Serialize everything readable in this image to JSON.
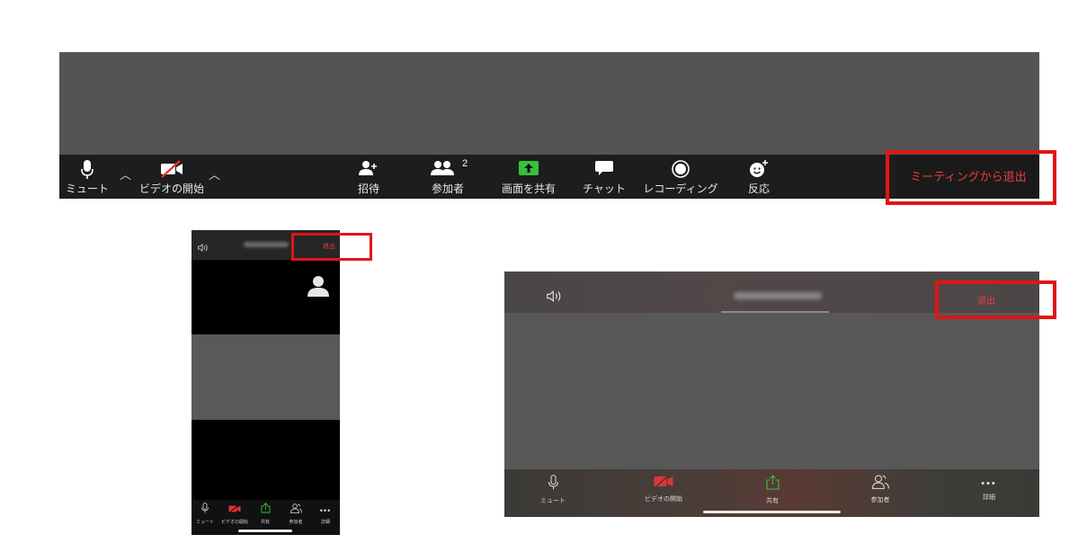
{
  "desktop": {
    "toolbar": {
      "mute_label": "ミュート",
      "video_label": "ビデオの開始",
      "invite_label": "招待",
      "participants_label": "参加者",
      "participants_count": "2",
      "share_label": "画面を共有",
      "chat_label": "チャット",
      "record_label": "レコーディング",
      "reactions_label": "反応",
      "leave_label": "ミーティングから退出"
    }
  },
  "phone": {
    "leave_label": "退出",
    "toolbar": {
      "mute_label": "ミュート",
      "video_label": "ビデオの開始",
      "share_label": "共有",
      "participants_label": "参加者",
      "more_label": "詳細"
    }
  },
  "tablet": {
    "leave_label": "退出",
    "toolbar": {
      "mute_label": "ミュート",
      "video_label": "ビデオの開始",
      "share_label": "共有",
      "participants_label": "参加者",
      "more_label": "詳細"
    }
  },
  "colors": {
    "leave_red": "#ef3f3f",
    "highlight_red": "#e01616",
    "share_green": "#35c13b",
    "video_off_red": "#e03434"
  }
}
